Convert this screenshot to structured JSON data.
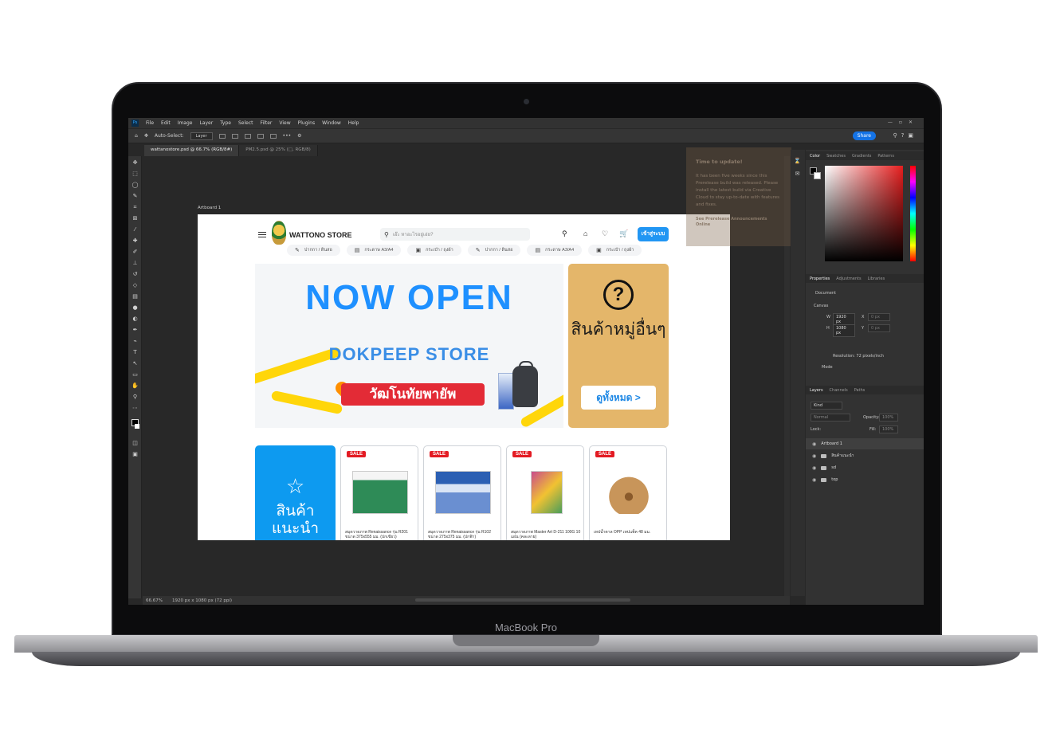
{
  "device": {
    "label": "MacBook Pro"
  },
  "app": {
    "menu": [
      "File",
      "Edit",
      "Image",
      "Layer",
      "Type",
      "Select",
      "Filter",
      "View",
      "Plugins",
      "Window",
      "Help"
    ],
    "options": {
      "auto_select": "Auto-Select:",
      "auto_select_value": "Layer"
    },
    "share_label": "Share",
    "tabs": [
      {
        "label": "wattanostore.psd @ 66.7% (RGB/8#)",
        "active": true
      },
      {
        "label": "PM2.5.psd @ 25% (□, RGB/8)",
        "active": false
      }
    ],
    "status": {
      "zoom": "66.67%",
      "doc_info": "1920 px x 1080 px (72 ppi)"
    },
    "artboard_label": "Artboard 1",
    "toast": {
      "title": "Time to update!",
      "body": "It has been five weeks since this Prerelease build was released. Please install the latest build via Creative Cloud to stay up-to-date with features and fixes.",
      "link": "See Prerelease Announcements Online"
    },
    "panels": {
      "color_tabs": [
        "Color",
        "Swatches",
        "Gradients",
        "Patterns"
      ],
      "properties_tabs": [
        "Properties",
        "Adjustments",
        "Libraries"
      ],
      "properties": {
        "doc_label": "Document",
        "canvas_label": "Canvas",
        "w_label": "W",
        "w_value": "1920 px",
        "h_label": "H",
        "h_value": "1080 px",
        "x_label": "X",
        "x_value": "0 px",
        "y_label": "Y",
        "y_value": "0 px",
        "resolution": "Resolution: 72 pixels/inch",
        "mode_label": "Mode"
      },
      "layers_tabs": [
        "Layers",
        "Channels",
        "Paths"
      ],
      "layers": {
        "kind": "Kind",
        "blend": "Normal",
        "opacity_label": "Opacity:",
        "opacity_value": "100%",
        "lock_label": "Lock:",
        "fill_label": "Fill:",
        "fill_value": "100%",
        "items": [
          "Artboard 1",
          "สินค้าแนะนำ",
          "sd",
          "top"
        ]
      }
    }
  },
  "site": {
    "brand": "WATTONO STORE",
    "search_placeholder": "เอ๊ะ หาอะไรอยู่เอ่ย?",
    "login_label": "เข้าสู่ระบบ",
    "categories": [
      "ปากกา / ดินสอ",
      "กระดาษ A3/A4",
      "กระเป๋า / ถุงผ้า",
      "ปากกา / ดินสอ",
      "กระดาษ A3/A4",
      "กระเป๋า / ถุงผ้า"
    ],
    "banner": {
      "headline": "NOW OPEN",
      "store": "DOKPEEP STORE",
      "location": "วัฒโนทัยพายัพ"
    },
    "side_banner": {
      "title": "สินค้าหมู่อื่นๆ",
      "button": "ดูทั้งหมด >"
    },
    "recommended_label": "สินค้าแนะนำ",
    "sale_badge": "SALE",
    "products": [
      {
        "name": "สมุดวาดภาพ Renaissance รุ่น R201 ขนาด 375x555 มม. (ปกเขียว)",
        "color": "#2e8b57"
      },
      {
        "name": "สมุดวาดภาพ Renaissance รุ่น R102 ขนาด 275x375 มม. (ปกฟ้า)",
        "color": "#2b5fb3"
      },
      {
        "name": "สมุดวาดภาพ Master Art D-211 100G 10 แผ่น (คละลาย)",
        "color": "#c94b8c"
      },
      {
        "name": "เทปน้ำตาล OPP เทปแพ็ค 48 มม.",
        "color": "#c8955a"
      }
    ]
  }
}
